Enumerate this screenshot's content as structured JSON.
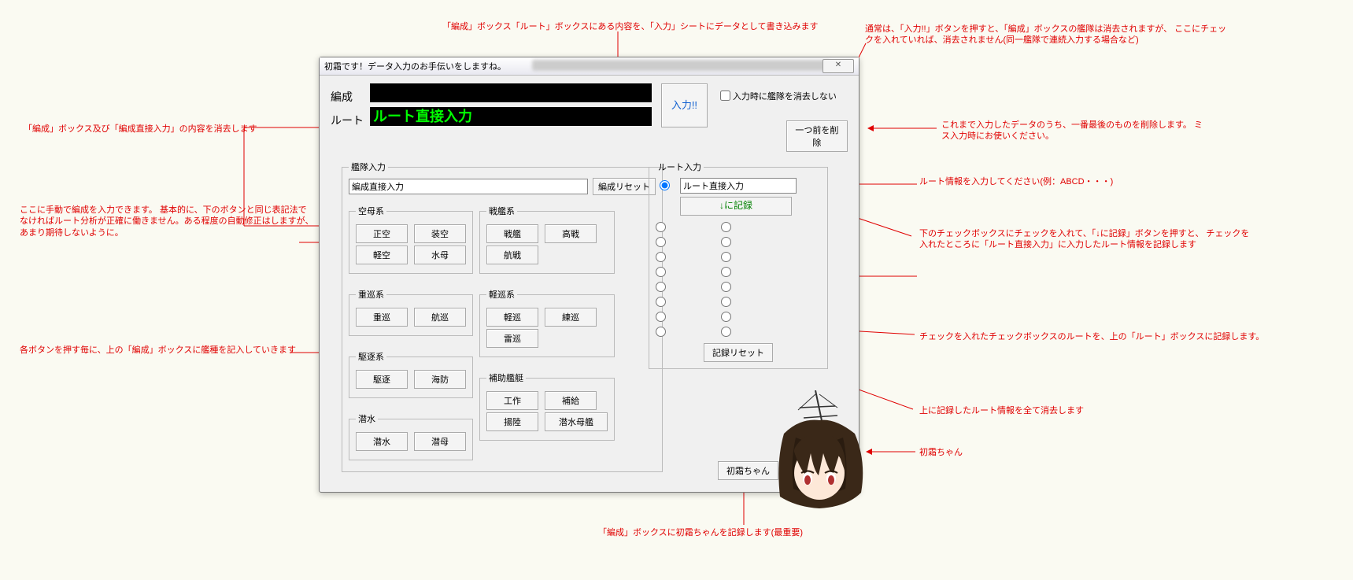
{
  "window": {
    "title": "初霜です！データ入力のお手伝いをしますね。",
    "close": "✕"
  },
  "top": {
    "hensei_label": "編成",
    "route_label": "ルート",
    "route_value": "ルート直接入力",
    "input_btn": "入力!!",
    "checkbox": "入力時に艦隊を消去しない",
    "delete_prev": "一つ前を削除"
  },
  "fleet": {
    "legend": "艦隊入力",
    "direct_value": "編成直接入力",
    "reset": "編成リセット",
    "groups": {
      "kubo": {
        "legend": "空母系",
        "btns": [
          "正空",
          "装空",
          "軽空",
          "水母"
        ]
      },
      "senkan": {
        "legend": "戦艦系",
        "btns": [
          "戦艦",
          "高戦",
          "航戦"
        ]
      },
      "juujun": {
        "legend": "重巡系",
        "btns": [
          "重巡",
          "航巡"
        ]
      },
      "keijun": {
        "legend": "軽巡系",
        "btns": [
          "軽巡",
          "練巡",
          "雷巡"
        ]
      },
      "kuchiku": {
        "legend": "駆逐系",
        "btns": [
          "駆逐",
          "海防"
        ]
      },
      "sensui": {
        "legend": "潜水",
        "btns": [
          "潜水",
          "潜母"
        ]
      },
      "hojo": {
        "legend": "補助艦艇",
        "btns": [
          "工作",
          "補給",
          "揚陸",
          "潜水母艦"
        ]
      }
    }
  },
  "route": {
    "legend": "ルート入力",
    "direct_value": "ルート直接入力",
    "record": "↓に記録",
    "reset": "記録リセット"
  },
  "hatsushimo_btn": "初霜ちゃん",
  "annotations": {
    "a1": "「編成」ボックス「ルート」ボックスにある内容を、「入力」シートにデータとして書き込みます",
    "a2": "通常は、「入力!!」ボタンを押すと、「編成」ボックスの艦隊は消去されますが、\nここにチェックを入れていれば、消去されません(同一艦隊で連続入力する場合など)",
    "a3": "「編成」ボックス及び「編成直接入力」の内容を消去します",
    "a4": "ここに手動で編成を入力できます。\n基本的に、下のボタンと同じ表記法でなければルート分析が正確に働きません。ある程度の自動修正はしますが、あまり期待しないように。",
    "a5": "各ボタンを押す毎に、上の「編成」ボックスに艦種を記入していきます",
    "a6": "これまで入力したデータのうち、一番最後のものを削除します。\nミス入力時にお使いください。",
    "a7": "ルート情報を入力してください(例：ABCD・・・)",
    "a8": "下のチェックボックスにチェックを入れて、「↓に記録」ボタンを押すと、\nチェックを入れたところに「ルート直接入力」に入力したルート情報を記録します",
    "a9": "チェックを入れたチェックボックスのルートを、上の「ルート」ボックスに記録します。",
    "a10": "上に記録したルート情報を全て消去します",
    "a11": "初霜ちゃん",
    "a12": "「編成」ボックスに初霜ちゃんを記録します(最重要)"
  }
}
